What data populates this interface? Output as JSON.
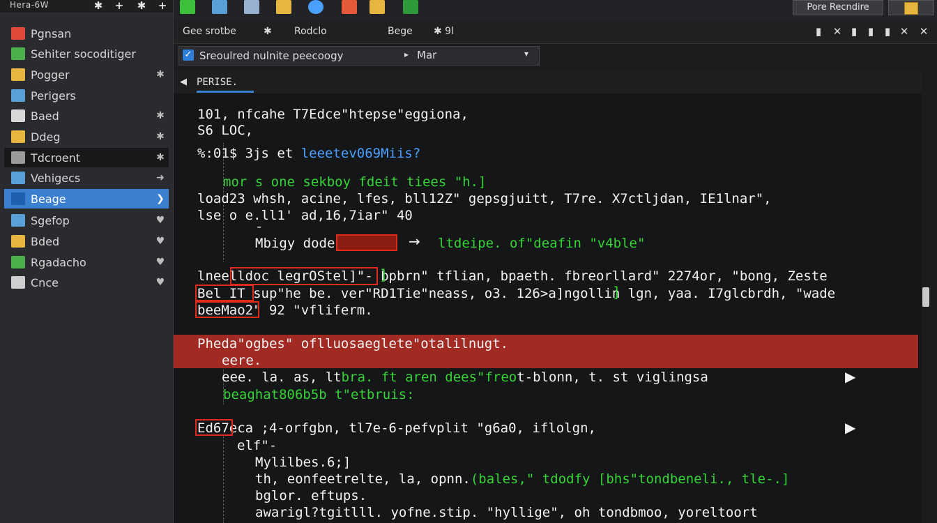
{
  "sidebar": {
    "title": "Hera-6W",
    "top_buttons": [
      "✱",
      "+",
      "✱",
      "+"
    ],
    "items": [
      {
        "label": "Pgnsan",
        "icon_color": "#e04a3a",
        "action": ""
      },
      {
        "label": "Sehiter socoditiger",
        "icon_color": "#4bb04b",
        "action": ""
      },
      {
        "label": "Pogger",
        "icon_color": "#e6b640",
        "action": "✱"
      },
      {
        "label": "Perigers",
        "icon_color": "#5aa0d8",
        "action": ""
      },
      {
        "label": "Baed",
        "icon_color": "#d8d8d8",
        "action": "✱"
      },
      {
        "label": "Ddeg",
        "icon_color": "#e6b640",
        "action": "✱"
      },
      {
        "label": "Tdcroent",
        "icon_color": "#9a9a9a",
        "action": "✱"
      },
      {
        "label": "Vehigecs",
        "icon_color": "#5aa0d8",
        "action": "➜"
      },
      {
        "label": "Beage",
        "icon_color": "#2f7fd8",
        "action": "❯"
      },
      {
        "label": "Sgefop",
        "icon_color": "#5aa0d8",
        "action": "♥"
      },
      {
        "label": "Bded",
        "icon_color": "#e6b640",
        "action": "♥"
      },
      {
        "label": "Rgadacho",
        "icon_color": "#4bb04b",
        "action": "♥"
      },
      {
        "label": "Cnce",
        "icon_color": "#cfcfcf",
        "action": "♥"
      }
    ]
  },
  "toolbar": {
    "icons": [
      "#3cc03c",
      "#5aa0d8",
      "#9ab0d0",
      "#e6b640",
      "#4aa0ff",
      "#e65a3a",
      "#e6b640",
      "#2f9a3a"
    ],
    "right_button": "Pore Recndire"
  },
  "menubar": {
    "items": [
      "Gee srotbe",
      "✱",
      "Rodclo",
      "Bege",
      "✱ 9l"
    ],
    "window_controls": [
      "▮",
      "✕",
      "▮",
      "▮",
      "▮",
      "✕",
      "✕"
    ]
  },
  "filter": {
    "text": "Sreoulred nulnite peecoogy",
    "separator": "▸",
    "lang": "Mar",
    "drop": "▾"
  },
  "editor": {
    "tab_label": "PERISE.",
    "lines": {
      "l1": "101, nfcahe T7Edce\"htepse\"eggiona,",
      "l2": "S6 LOC,",
      "l3a": "%:01$ 3js et ",
      "l3b": "leeetev069Miis?",
      "l4": "mor s one sekboy fdeit tiees \"h.]",
      "l5": "load23 whsh, acine, lfes, bll12Z\" gepsgjuitt, T7re. X7ctljdan, IE1lnar\",",
      "l6": "lse o e.ll1' ad,16,7iar\" 40",
      "l7": "-",
      "l8a": "Mbigy dodeb",
      "l8b": "ltdeipe. of\"deafin \"v4ble\"",
      "l9": "lneelldoc legrOStel]\"- bpbrn\" tflian, bpaeth. fbreorllard\" 2274or, \"bong, Zeste",
      "l10": "Bel IT sup\"he be. ver\"RD1Tie\"neass, o3. 126>a]ngollin lgn, yaa. I7glcbrdh, \"wade",
      "l11": "beeMao2\" 92 \"vfliferm.",
      "l12": "Pheda\"ogbes\" oflluosaeglete\"otalilnugt.",
      "l13": "eere.",
      "l14a": "eee. la. as, lt",
      "l14b": "bra. ft aren dees\"freo",
      "l14c": "t-blonn, t. st viglingsa",
      "l15": "beaghat806b5b t\"etbruis:",
      "l16": "Ed67eca ;4-orfgbn, tl7e-6-pefvplit \"g6a0, iflolgn,",
      "l17": "elf\"-",
      "l18": "Mylilbes.6;]",
      "l19a": "th, eonfeetrelte, la, opnn.",
      "l19b": "(bales,\" tdodfy [bhs\"tondbeneli., tle-.]",
      "l20": "bglor. eftups.",
      "l21": "awarigl?tgitlll. yofne.stip. \"hyllige\", oh tondbmoo, yoreltoort"
    }
  }
}
